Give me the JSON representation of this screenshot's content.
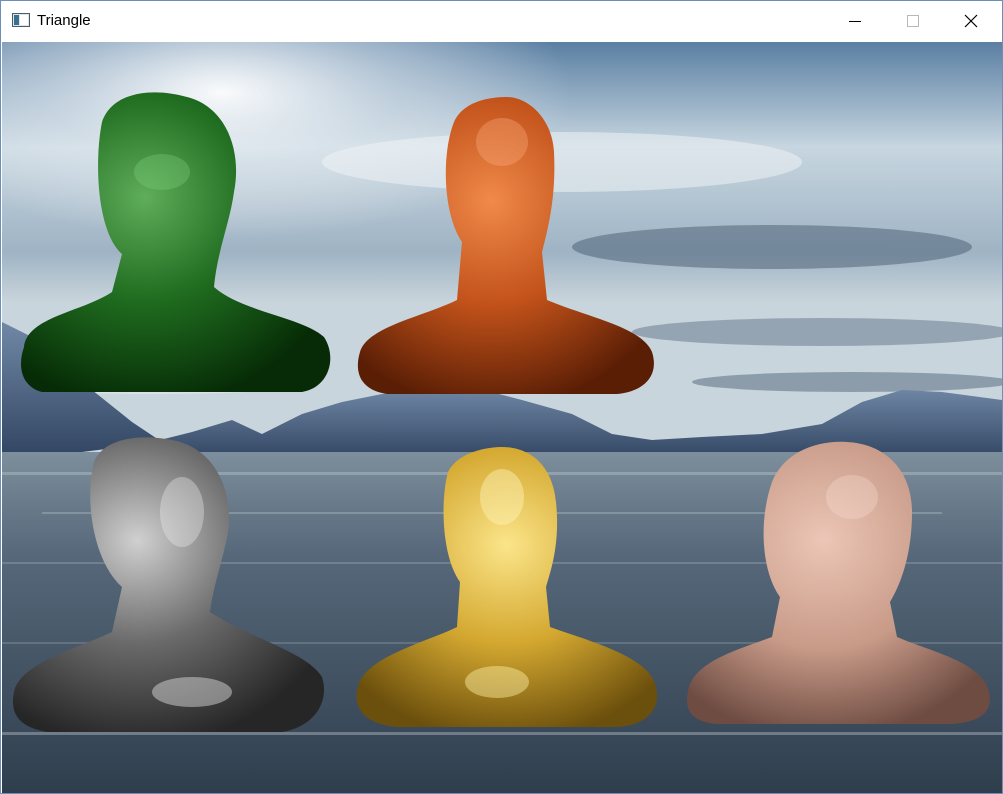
{
  "window": {
    "title": "Triangle",
    "controls": [
      "minimize-icon",
      "maximize-icon",
      "close-icon"
    ]
  },
  "scene": {
    "background": "sky-and-lake-skybox",
    "models": [
      {
        "name": "green-head-bust",
        "color": "#1f6b1f"
      },
      {
        "name": "orange-head-bust",
        "color": "#c2521a"
      },
      {
        "name": "gray-head-bust",
        "color": "#6a6a6a"
      },
      {
        "name": "gold-head-bust",
        "color": "#d4a830"
      },
      {
        "name": "skin-head-bust",
        "color": "#c89a88"
      }
    ]
  }
}
